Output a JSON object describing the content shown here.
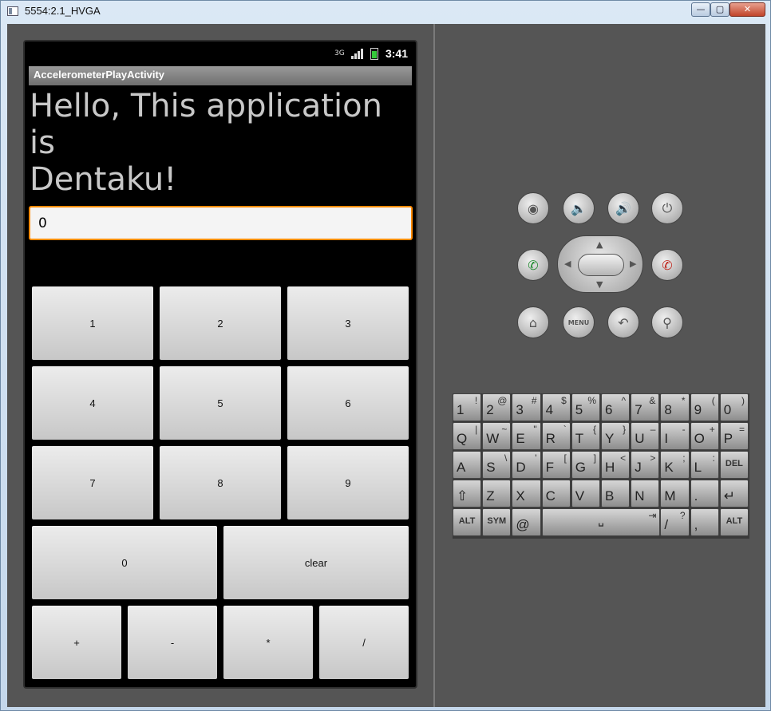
{
  "window": {
    "title": "5554:2.1_HVGA",
    "minimize": "—",
    "maximize": "▢",
    "close": "✕"
  },
  "phone": {
    "status": {
      "network": "3G",
      "time": "3:41"
    },
    "app_title": "AccelerometerPlayActivity",
    "hello_line1": "Hello, This application is",
    "hello_line2": "Dentaku!",
    "display_value": "0",
    "keys": {
      "k1": "1",
      "k2": "2",
      "k3": "3",
      "k4": "4",
      "k5": "5",
      "k6": "6",
      "k7": "7",
      "k8": "8",
      "k9": "9",
      "k0": "0",
      "clear": "clear",
      "plus": "+",
      "minus": "-",
      "mul": "*",
      "div": "/"
    }
  },
  "controls": {
    "camera": "camera-icon",
    "vol_down": "volume-down-icon",
    "vol_up": "volume-up-icon",
    "power": "power-icon",
    "call": "call-icon",
    "end_call": "end-call-icon",
    "home": "home-icon",
    "menu": "MENU",
    "back": "back-icon",
    "search": "search-icon"
  },
  "keyboard": {
    "row1": [
      {
        "main": "1",
        "sub": "!"
      },
      {
        "main": "2",
        "sub": "@"
      },
      {
        "main": "3",
        "sub": "#"
      },
      {
        "main": "4",
        "sub": "$"
      },
      {
        "main": "5",
        "sub": "%"
      },
      {
        "main": "6",
        "sub": "^"
      },
      {
        "main": "7",
        "sub": "&"
      },
      {
        "main": "8",
        "sub": "*"
      },
      {
        "main": "9",
        "sub": "("
      },
      {
        "main": "0",
        "sub": ")"
      }
    ],
    "row2": [
      {
        "main": "Q",
        "sub": "|"
      },
      {
        "main": "W",
        "sub": "~"
      },
      {
        "main": "E",
        "sub": "\""
      },
      {
        "main": "R",
        "sub": "`"
      },
      {
        "main": "T",
        "sub": "{"
      },
      {
        "main": "Y",
        "sub": "}"
      },
      {
        "main": "U",
        "sub": "–"
      },
      {
        "main": "I",
        "sub": "-"
      },
      {
        "main": "O",
        "sub": "+"
      },
      {
        "main": "P",
        "sub": "="
      }
    ],
    "row3": [
      {
        "main": "A",
        "sub": ""
      },
      {
        "main": "S",
        "sub": "\\"
      },
      {
        "main": "D",
        "sub": "'"
      },
      {
        "main": "F",
        "sub": "["
      },
      {
        "main": "G",
        "sub": "]"
      },
      {
        "main": "H",
        "sub": "<"
      },
      {
        "main": "J",
        "sub": ">"
      },
      {
        "main": "K",
        "sub": ";"
      },
      {
        "main": "L",
        "sub": ":"
      },
      {
        "main": "DEL",
        "sub": ""
      }
    ],
    "row4": [
      {
        "main": "⇧",
        "sub": ""
      },
      {
        "main": "Z",
        "sub": ""
      },
      {
        "main": "X",
        "sub": ""
      },
      {
        "main": "C",
        "sub": ""
      },
      {
        "main": "V",
        "sub": ""
      },
      {
        "main": "B",
        "sub": ""
      },
      {
        "main": "N",
        "sub": ""
      },
      {
        "main": "M",
        "sub": ""
      },
      {
        "main": ".",
        "sub": ""
      },
      {
        "main": "↵",
        "sub": ""
      }
    ],
    "row5": {
      "alt_left": "ALT",
      "sym": "SYM",
      "at": "@",
      "space": "␣",
      "tab": "⇥",
      "slash": "/",
      "question": "?",
      "comma": ",",
      "alt_right": "ALT"
    }
  }
}
